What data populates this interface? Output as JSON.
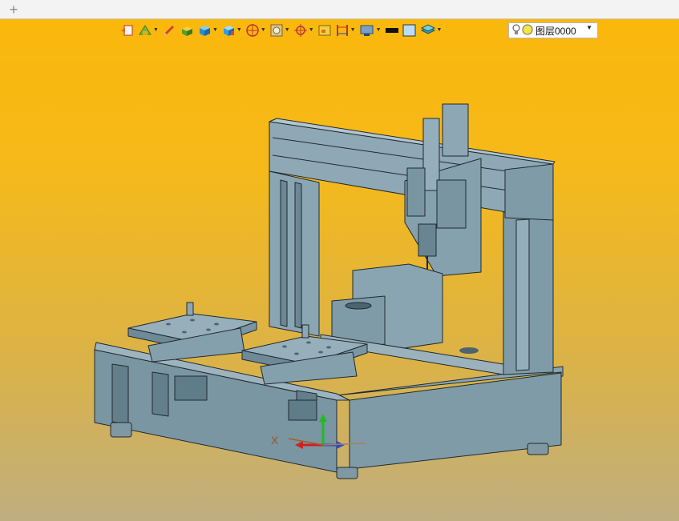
{
  "tabbar": {
    "new_tab_label": "+"
  },
  "toolbar": {
    "buttons": [
      {
        "name": "display-mode-icon"
      },
      {
        "name": "render-style-icon",
        "dropdown": true
      },
      {
        "name": "pencil-icon"
      },
      {
        "name": "shaded-solid-icon"
      },
      {
        "name": "blue-solid-icon",
        "dropdown": true
      },
      {
        "name": "view-cube-icon",
        "dropdown": true
      },
      {
        "name": "section-view-icon",
        "dropdown": true
      },
      {
        "name": "zoom-view-icon",
        "dropdown": true
      },
      {
        "name": "rotate-center-icon",
        "dropdown": true
      },
      {
        "name": "fit-window-icon"
      },
      {
        "name": "dimension-icon",
        "dropdown": true
      },
      {
        "name": "monitor-settings-icon",
        "dropdown": true
      },
      {
        "name": "line-color-icon"
      },
      {
        "name": "fill-color-icon"
      },
      {
        "name": "layers-icon",
        "dropdown": true
      }
    ],
    "layer_select": {
      "value": "图层0000"
    }
  },
  "triad": {
    "x_label": "X"
  },
  "colors": {
    "viewport_top": "#fbb80c",
    "viewport_bottom": "#bfae80",
    "part_fill": "#7d9aa8",
    "part_edge": "#1f2a30"
  }
}
